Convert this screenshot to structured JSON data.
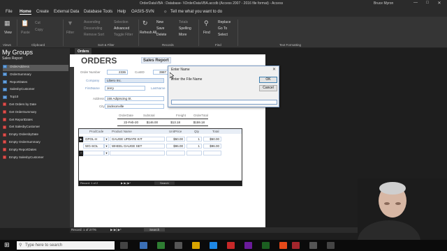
{
  "window": {
    "title": "OrderDataVBA : Database- \\\\OrderDataVBA.accdb (Access 2007 - 2016 file format) - Access",
    "user": "Bruce Myron"
  },
  "menu": {
    "tabs": [
      "File",
      "Home",
      "Create",
      "External Data",
      "Database Tools",
      "Help",
      "OASIS-SVN"
    ],
    "tell_me": "Tell me what you want to do"
  },
  "ribbon": {
    "groups": [
      "Views",
      "Clipboard",
      "Sort & Filter",
      "Records",
      "Find",
      "Text Formatting"
    ],
    "buttons": {
      "view": "View",
      "paste": "Paste",
      "cut": "Cut",
      "copy": "Copy",
      "filter": "Filter",
      "ascending": "Ascending",
      "descending": "Descending",
      "remove_sort": "Remove Sort",
      "selection": "Selection",
      "advanced": "Advanced",
      "toggle_filter": "Toggle Filter",
      "refresh_all": "Refresh All",
      "new": "New",
      "save": "Save",
      "delete": "Delete",
      "totals": "Totals",
      "spelling": "Spelling",
      "more": "More",
      "find": "Find",
      "replace": "Replace",
      "goto": "Go To",
      "select": "Select"
    }
  },
  "nav": {
    "header": "My Groups",
    "subheader": "Sales Report",
    "items": [
      {
        "label": "OrderAddress",
        "kind": "form",
        "selected": true
      },
      {
        "label": "OrderSummary",
        "kind": "form"
      },
      {
        "label": "ReportDates",
        "kind": "form"
      },
      {
        "label": "SalesbyCustomer",
        "kind": "form"
      },
      {
        "label": "Top10",
        "kind": "form"
      },
      {
        "label": "Get Orders by Date",
        "kind": "query"
      },
      {
        "label": "Get OrderSummary",
        "kind": "query"
      },
      {
        "label": "Get ReportDates",
        "kind": "query"
      },
      {
        "label": "Get SalesbyCustomer",
        "kind": "query"
      },
      {
        "label": "Empty OrdersbyDate",
        "kind": "query"
      },
      {
        "label": "Empty OrderSummary",
        "kind": "query"
      },
      {
        "label": "Empty ReportDates",
        "kind": "query"
      },
      {
        "label": "Empty SalesbyCustomer",
        "kind": "query"
      }
    ]
  },
  "document": {
    "tab": "Orders",
    "sales_report_button": "Sales Report",
    "form_title": "ORDERS",
    "order_number_label": "Order Number",
    "order_number": "2336",
    "custid_label": "CustID",
    "custid": "3987",
    "company_label": "Company",
    "company": "Libero Inc.",
    "firstname_label": "FirstName",
    "firstname": "Jerry",
    "lastname_label": "LastName",
    "address_label": "Address",
    "address": "155 Adipiscing St.",
    "city_label": "City",
    "city": "Jacksonville",
    "orderdate_label": "OrderDate",
    "subtotal_label": "Subtotal",
    "freight_label": "Freight",
    "ordertotal_label": "OrderTotal",
    "orderdate": "22-Feb-20",
    "subtotal": "$146.00",
    "freight": "$13.18",
    "ordertotal": "$159.18"
  },
  "subform": {
    "columns": [
      "ProdCode",
      "Product Name",
      "UnitPrice",
      "Qty",
      "Total"
    ],
    "rows": [
      {
        "code": "GPOL-H",
        "name": "GAUGE UPDATE KIT",
        "price": "$50.00",
        "qty": "1",
        "total": "$50.00"
      },
      {
        "code": "WG-SOL",
        "name": "WHEEL GAUGE SET",
        "price": "$96.00",
        "qty": "1",
        "total": "$96.00"
      }
    ],
    "nav_record": "Record: 1 of 2",
    "nav_search": "Search"
  },
  "statusbar": {
    "record": "Record: 1 of 2776",
    "search": "Search"
  },
  "dialog": {
    "title": "Enter Name",
    "prompt": "Enter the File Name",
    "ok": "OK",
    "cancel": "Cancel",
    "input_value": ""
  },
  "taskbar": {
    "search_placeholder": "Type here to search"
  }
}
